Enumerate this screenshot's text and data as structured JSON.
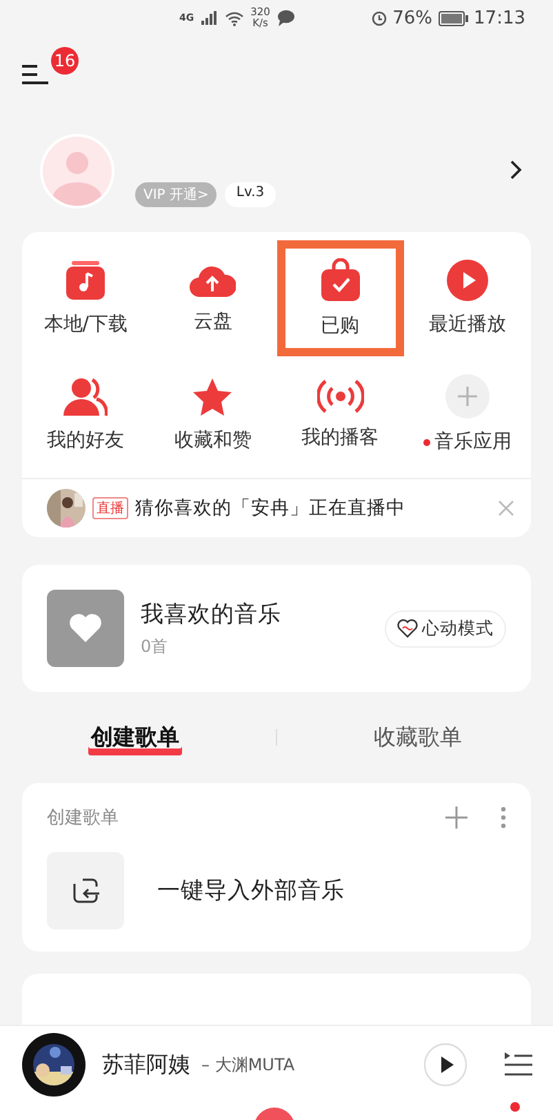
{
  "status_bar": {
    "network": "4G",
    "speed": "320",
    "speed_unit": "K/s",
    "battery": "76%",
    "time": "17:13"
  },
  "menu_badge": "16",
  "profile": {
    "vip_label": "VIP 开通>",
    "level": "Lv.3"
  },
  "shortcuts": [
    {
      "label": "本地/下载",
      "highlighted": false,
      "dot": false
    },
    {
      "label": "云盘",
      "highlighted": false,
      "dot": false
    },
    {
      "label": "已购",
      "highlighted": true,
      "dot": false
    },
    {
      "label": "最近播放",
      "highlighted": false,
      "dot": false
    },
    {
      "label": "我的好友",
      "highlighted": false,
      "dot": false
    },
    {
      "label": "收藏和赞",
      "highlighted": false,
      "dot": false
    },
    {
      "label": "我的播客",
      "highlighted": false,
      "dot": false
    },
    {
      "label": "音乐应用",
      "highlighted": false,
      "dot": true
    }
  ],
  "live_banner": {
    "tag": "直播",
    "text": "猜你喜欢的「安冉」正在直播中"
  },
  "liked": {
    "title": "我喜欢的音乐",
    "count": "0首",
    "mode_button": "心动模式"
  },
  "tabs": [
    {
      "label": "创建歌单",
      "selected": true
    },
    {
      "label": "收藏歌单",
      "selected": false
    }
  ],
  "playlists": {
    "header": "创建歌单",
    "import_label": "一键导入外部音乐"
  },
  "player": {
    "song": "苏菲阿姨",
    "artist": "– 大渊MUTA"
  }
}
